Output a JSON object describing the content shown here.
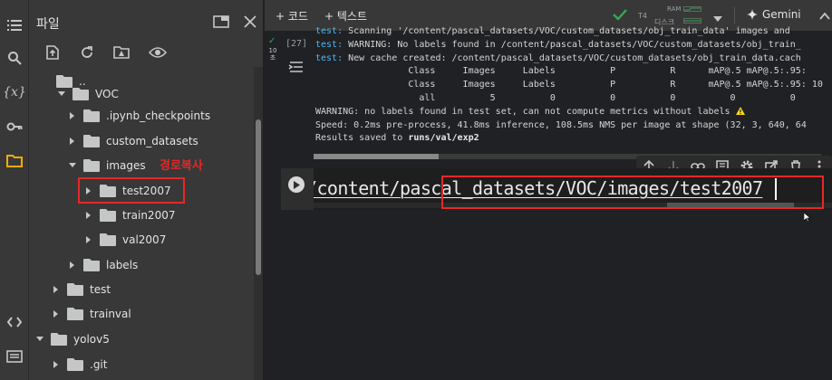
{
  "file_panel": {
    "title": "파일",
    "toolbar": [
      "upload-icon",
      "refresh-icon",
      "drive-icon",
      "eye-icon"
    ],
    "tree": [
      {
        "label": "..",
        "depth": 0,
        "caret": "none"
      },
      {
        "label": "VOC",
        "depth": 1,
        "caret": "down"
      },
      {
        "label": ".ipynb_checkpoints",
        "depth": 2,
        "caret": "right"
      },
      {
        "label": "custom_datasets",
        "depth": 2,
        "caret": "right"
      },
      {
        "label": "images",
        "depth": 2,
        "caret": "down"
      },
      {
        "label": "test2007",
        "depth": 3,
        "caret": "right"
      },
      {
        "label": "train2007",
        "depth": 3,
        "caret": "right"
      },
      {
        "label": "val2007",
        "depth": 3,
        "caret": "right"
      },
      {
        "label": "labels",
        "depth": 2,
        "caret": "right"
      },
      {
        "label": "test",
        "depth": 1,
        "caret": "right"
      },
      {
        "label": "trainval",
        "depth": 1,
        "caret": "right"
      },
      {
        "label": "yolov5",
        "depth": 0,
        "caret": "down"
      },
      {
        "label": ".git",
        "depth": 1,
        "caret": "right"
      }
    ],
    "annotation": "경로복사"
  },
  "toolbar": {
    "add_code": "+ 코드",
    "add_text": "+ 텍스트",
    "gpu": "T4",
    "ram": "RAM",
    "disk": "디스크",
    "gemini": "Gemini"
  },
  "output_cell": {
    "run_count": "[27]",
    "run_time": "10\n초",
    "lines": [
      {
        "prefix": "test:",
        "text": " Scanning '/content/pascal_datasets/VOC/custom_datasets/obj_train_data' images and"
      },
      {
        "prefix": "test:",
        "text": " WARNING: No labels found in /content/pascal_datasets/VOC/custom_datasets/obj_train_"
      },
      {
        "prefix": "test:",
        "text": " New cache created: /content/pascal_datasets/VOC/custom_datasets/obj_train_data.cach"
      },
      {
        "prefix": "",
        "text": "                 Class     Images     Labels          P          R      mAP@.5 mAP@.5:.95:"
      },
      {
        "prefix": "",
        "text": "                 Class     Images     Labels          P          R      mAP@.5 mAP@.5:.95: 10"
      },
      {
        "prefix": "",
        "text": "                   all          5          0          0          0          0          0"
      },
      {
        "prefix": "",
        "text": "WARNING: no labels found in test set, can not compute metrics without labels "
      },
      {
        "prefix": "",
        "text": "Speed: 0.2ms pre-process, 41.8ms inference, 108.5ms NMS per image at shape (32, 3, 640, 64"
      },
      {
        "prefix": "",
        "text": "Results saved to "
      }
    ],
    "results_path": "runs/val/exp2"
  },
  "code_cell": {
    "code": "/content/pascal_datasets/VOC/images/test2007"
  },
  "colors": {
    "accent_red": "#e62828",
    "link_blue": "#4fb4f6",
    "ok_green": "#34a853"
  }
}
